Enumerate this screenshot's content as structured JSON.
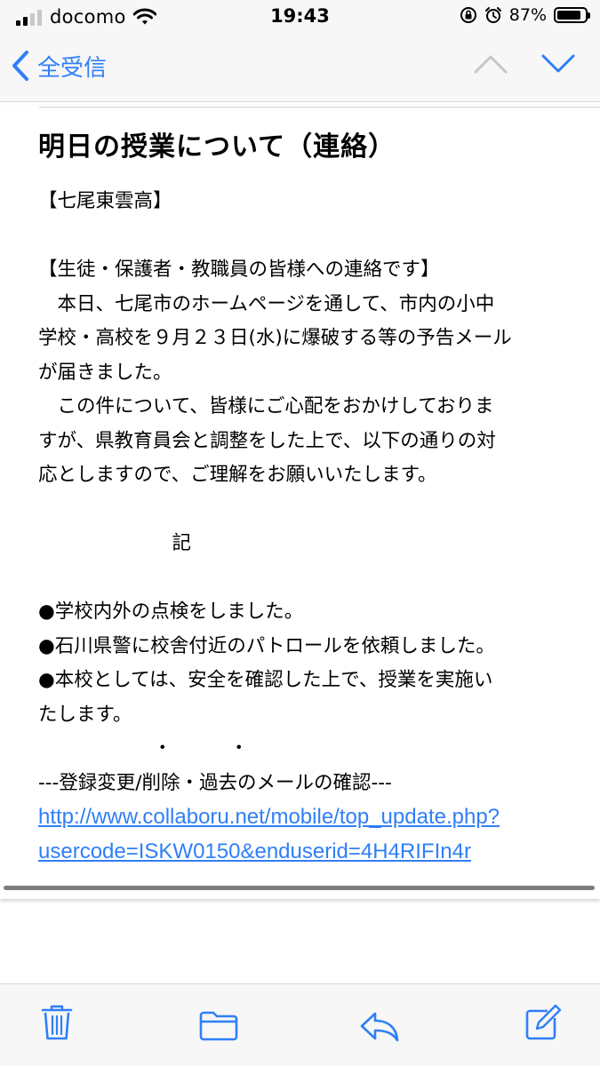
{
  "status_bar": {
    "carrier": "docomo",
    "time": "19:43",
    "battery_percent": "87%",
    "signal_bars": 2
  },
  "nav": {
    "back_label": "全受信",
    "accent_color": "#2f7ff7"
  },
  "message": {
    "subject": "明日の授業について（連絡）",
    "lines": [
      "【七尾東雲高】",
      "",
      "【生徒・保護者・教職員の皆様への連絡です】",
      "　本日、七尾市のホームページを通して、市内の小中",
      "学校・高校を９月２３日(水)に爆破する等の予告メール",
      "が届きました。",
      "　この件について、皆様にご心配をおかけしておりま",
      "すが、県教育員会と調整をした上で、以下の通りの対",
      "応としますので、ご理解をお願いいたします。",
      "",
      "　　　　　　　記",
      "",
      "●学校内外の点検をしました。",
      "●石川県警に校舎付近のパトロールを依頼しました。",
      "●本校としては、安全を確認した上で、授業を実施い",
      "たします。",
      "　　　　　　・　　　・",
      "---登録変更/削除・過去のメールの確認---"
    ],
    "link_lines": [
      "http://www.collaboru.net/mobile/top_update.php?",
      "usercode=ISKW0150&enduserid=4H4RIFIn4r"
    ]
  },
  "toolbar": {
    "icons": [
      "trash-icon",
      "folder-icon",
      "reply-icon",
      "compose-icon"
    ]
  }
}
